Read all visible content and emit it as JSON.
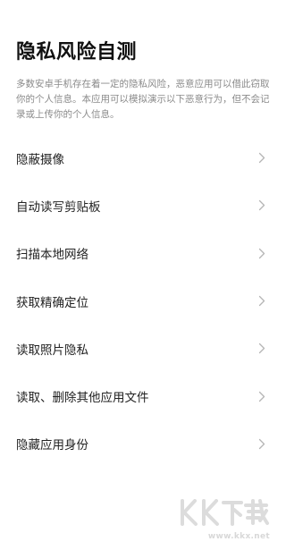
{
  "page": {
    "title": "隐私风险自测",
    "description": "多数安卓手机存在着一定的隐私风险，恶意应用可以借此窃取你的个人信息。本应用可以模拟演示以下恶意行为，但不会记录或上传你的个人信息。"
  },
  "menu": {
    "items": [
      {
        "label": "隐蔽摄像",
        "icon": "chevron-right-icon"
      },
      {
        "label": "自动读写剪贴板",
        "icon": "chevron-right-icon"
      },
      {
        "label": "扫描本地网络",
        "icon": "chevron-right-icon"
      },
      {
        "label": "获取精确定位",
        "icon": "chevron-right-icon"
      },
      {
        "label": "读取照片隐私",
        "icon": "chevron-right-icon"
      },
      {
        "label": "读取、删除其他应用文件",
        "icon": "chevron-right-icon"
      },
      {
        "label": "隐藏应用身份",
        "icon": "chevron-right-icon"
      }
    ]
  },
  "watermark": {
    "logo_text": "KK下载",
    "url": "www.kkx.net"
  },
  "colors": {
    "title": "#111111",
    "description": "#8a8a8a",
    "item_text": "#222222",
    "chevron": "#b5b5b5",
    "watermark": "#d2d2d2"
  }
}
